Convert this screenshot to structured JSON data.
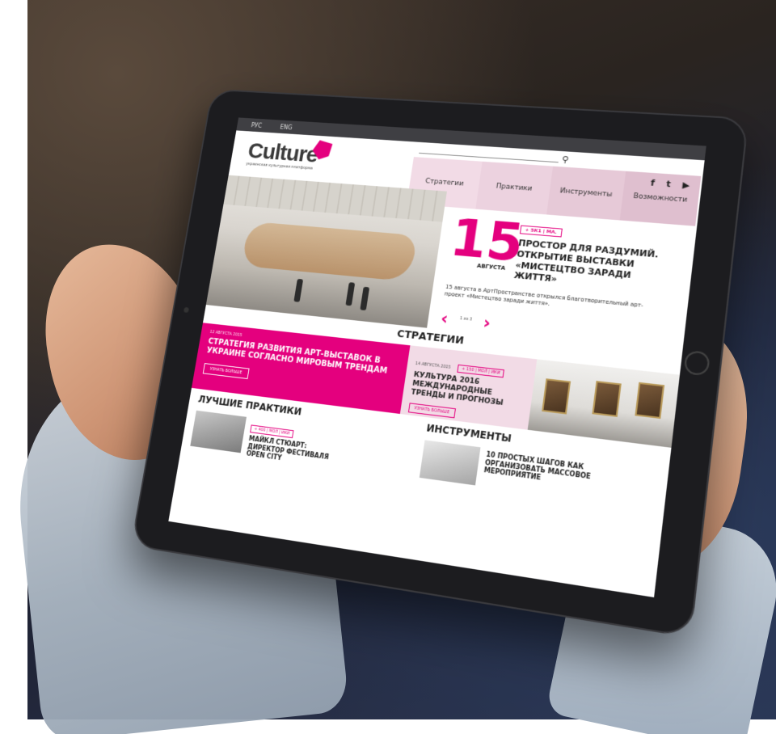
{
  "topbar": {
    "lang_ru": "РУС",
    "lang_en": "ENG"
  },
  "header": {
    "logo_text": "Culture",
    "logo_sub": "украинская культурная платформа",
    "social": [
      "f",
      "t",
      "▶"
    ]
  },
  "nav": {
    "items": [
      "Стратегии",
      "Практики",
      "Инструменты",
      "Возможности"
    ]
  },
  "hero": {
    "day": "15",
    "month": "АВГУСТА",
    "tag": "+ 5К1 | МА.",
    "title": "ПРОСТОР ДЛЯ РАЗДУМИЙ. ОТКРЫТИЕ ВЫСТАВКИ «МИСТЕЦТВО ЗАРАДИ ЖИТТЯ»",
    "desc": "15 августа в АртПространстве открылся благотворительный арт-проект «Мистецтво заради життя».",
    "pager": "1 из 3"
  },
  "strategies": {
    "section_title": "СТРАТЕГИИ",
    "main": {
      "date": "12 АВГУСТА 2015",
      "title": "СТРАТЕГИЯ РАЗВИТИЯ АРТ-ВЫСТАВОК В УКРАИНЕ СОГЛАСНО МИРОВЫМ ТРЕНДАМ",
      "button": "УЗНАТЬ БОЛЬШЕ"
    },
    "side": {
      "date": "14 АВГУСТА 2015",
      "tag": "+ 150 | МОЛ | ИКИ",
      "title": "КУЛЬТУРА 2016 МЕЖДУНАРОДНЫЕ ТРЕНДЫ И ПРОГНОЗЫ",
      "button": "УЗНАТЬ БОЛЬШЕ"
    }
  },
  "practices": {
    "section_title": "ЛУЧШИЕ ПРАКТИКИ",
    "card": {
      "tag": "+ 400 | МОЛ | ИКИ",
      "title": "МАЙКЛ СТЮАРТ: ДИРЕКТОР ФЕСТИВАЛЯ OPEN CITY"
    }
  },
  "tools": {
    "section_title": "ИНСТРУМЕНТЫ",
    "card": {
      "title": "10 ПРОСТЫХ ШАГОВ КАК ОРГАНИЗОВАТЬ МАССОВОЕ МЕРОПРИЯТИЕ"
    }
  },
  "colors": {
    "accent": "#e4007e",
    "nav_bg": "#e8cfdd",
    "side_bg": "#f2dbe6",
    "topbar": "#3f3f43"
  }
}
